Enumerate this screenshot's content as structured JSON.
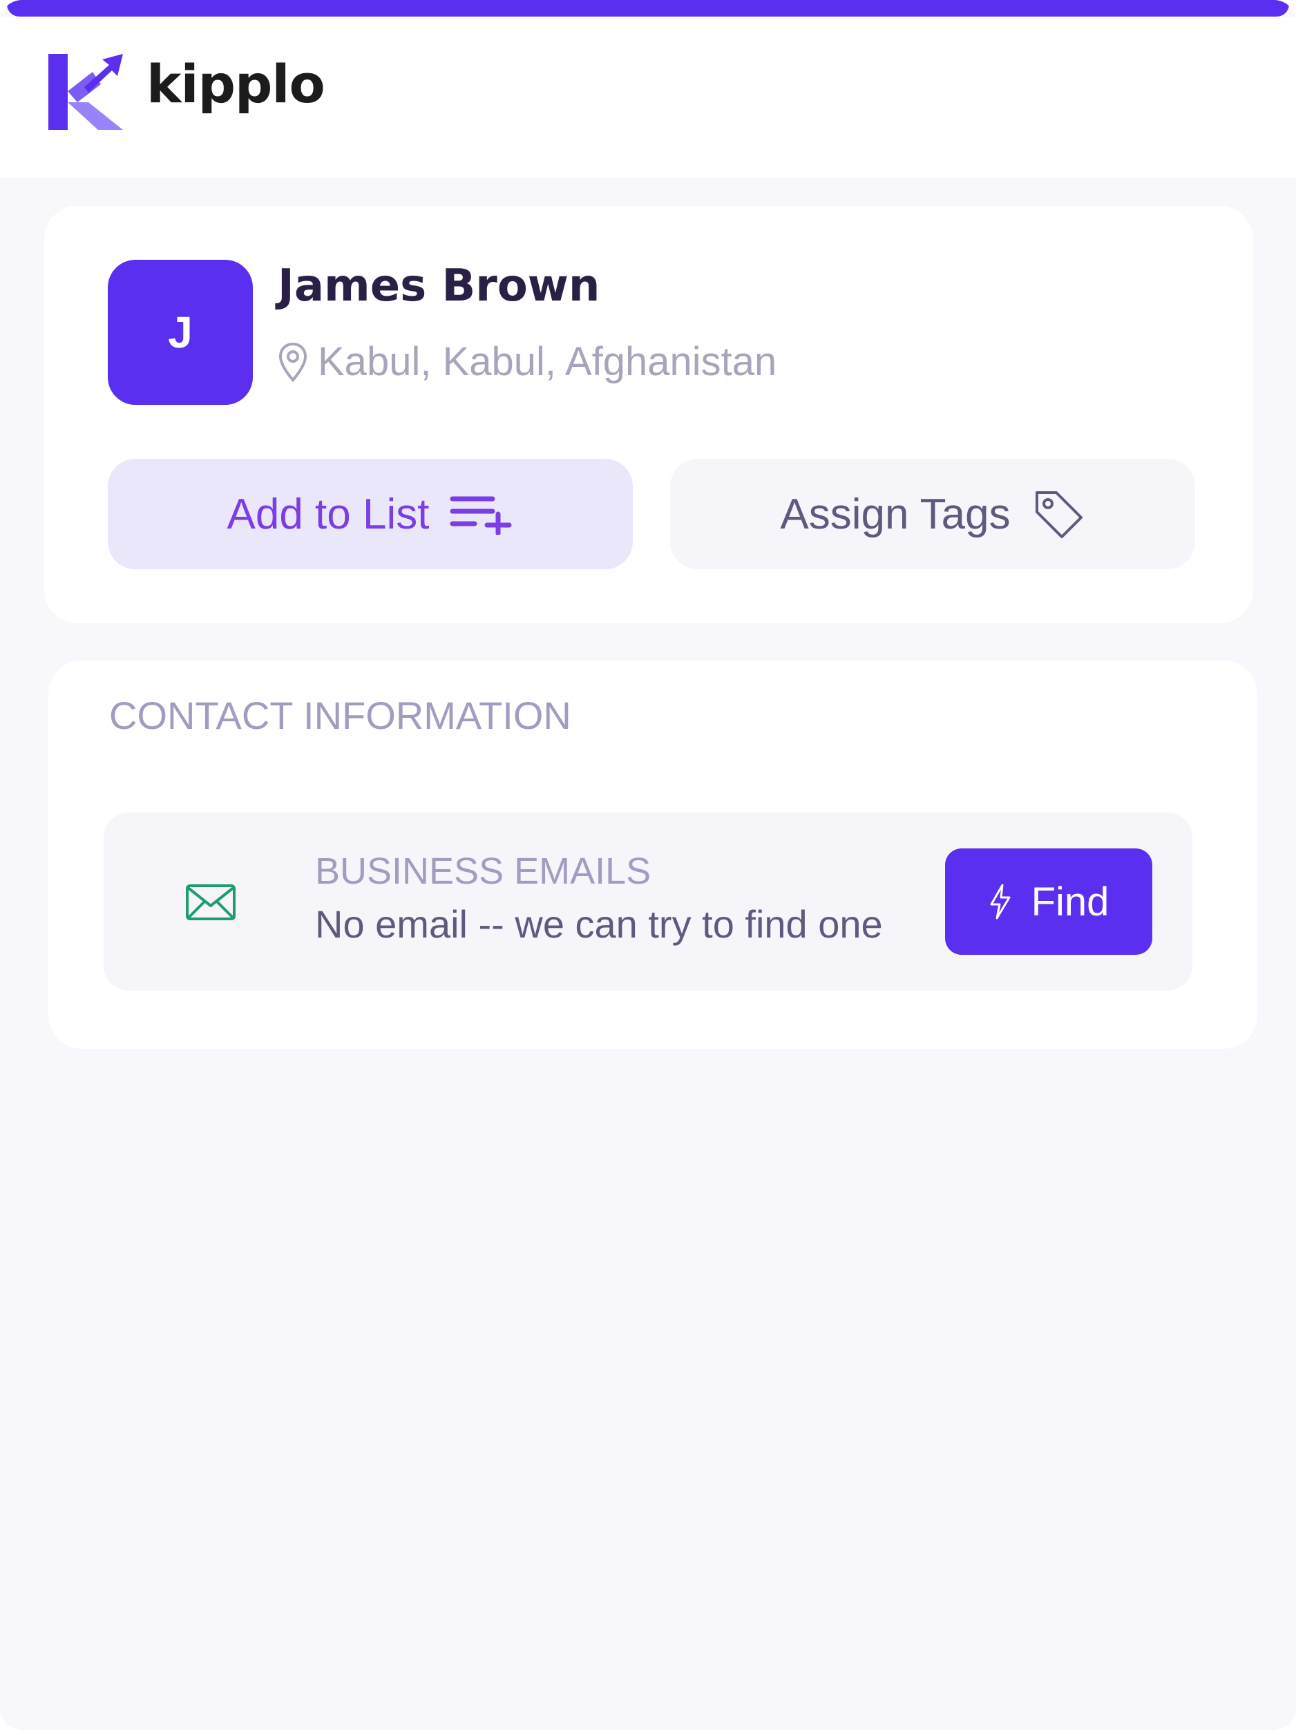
{
  "brand": {
    "name": "kipplo",
    "logo_icon": "kipplo-k-arrow-logo",
    "accent_color": "#5a2ff0"
  },
  "profile": {
    "avatar_initial": "J",
    "name": "James Brown",
    "location_icon": "map-pin-icon",
    "location": "Kabul, Kabul, Afghanistan",
    "add_to_list_label": "Add to List",
    "add_to_list_icon": "list-add-icon",
    "assign_tags_label": "Assign Tags",
    "assign_tags_icon": "tag-icon"
  },
  "contact": {
    "section_title": "CONTACT INFORMATION",
    "business_emails": {
      "icon": "mail-icon",
      "label": "BUSINESS EMAILS",
      "value": "No email -- we can try to find one",
      "find_label": "Find",
      "find_icon": "lightning-icon"
    }
  }
}
